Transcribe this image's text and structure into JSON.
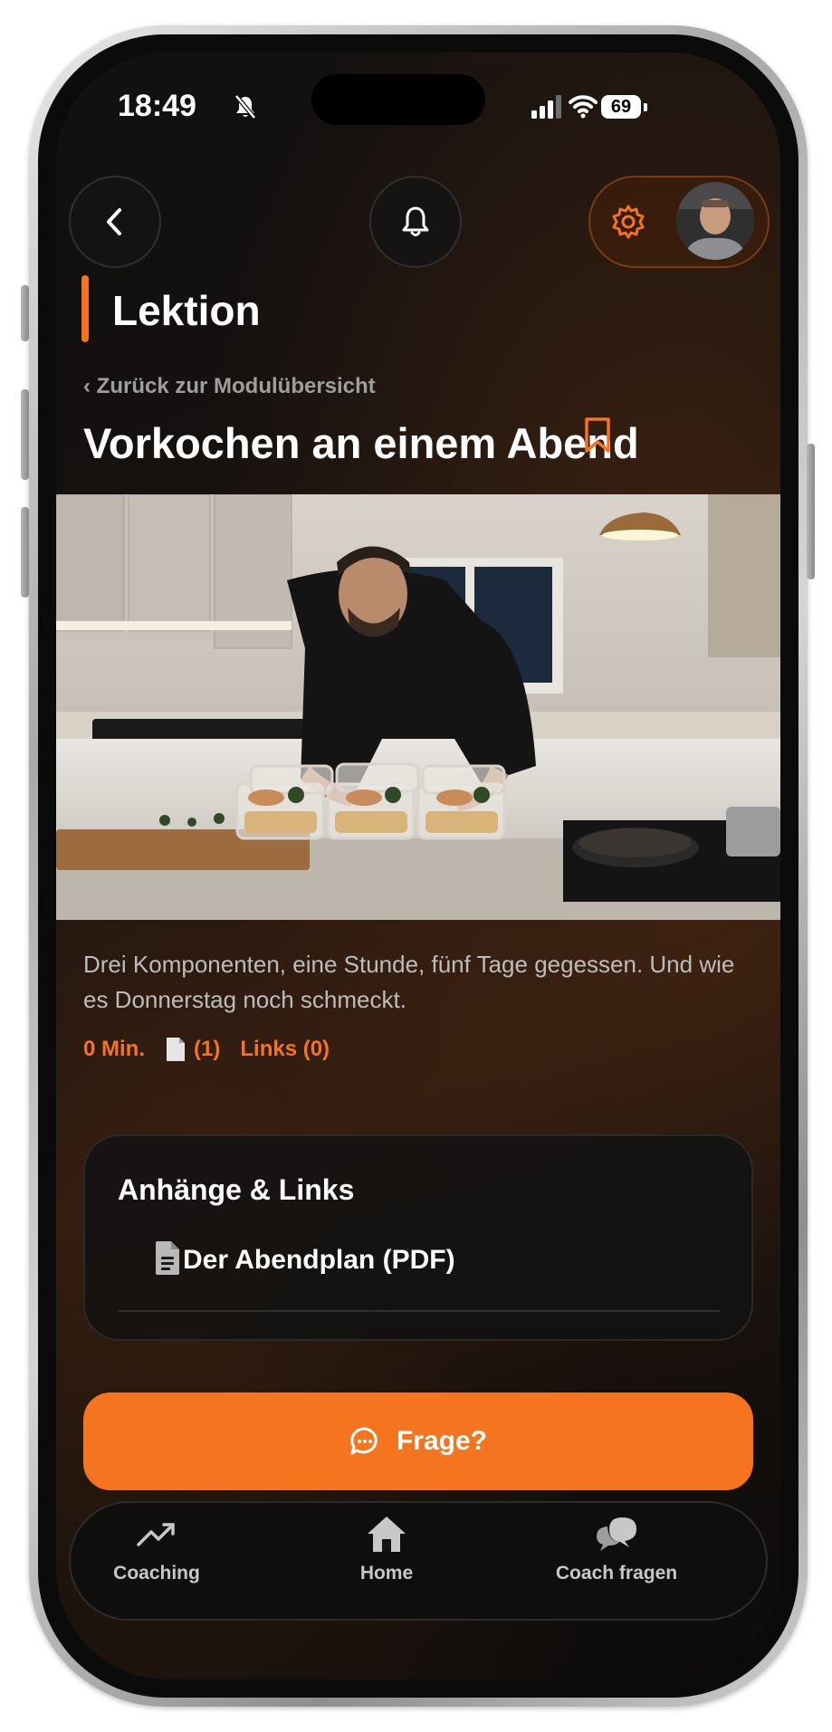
{
  "status_bar": {
    "time": "18:49",
    "battery": "69"
  },
  "header": {
    "back_icon": "chevron-left-icon",
    "bell_icon": "bell-icon",
    "settings_icon": "gear-icon"
  },
  "page": {
    "section_title": "Lektion",
    "back_link": "‹ Zurück zur Modulübersicht",
    "lesson_title": "Vorkochen an einem Abend",
    "description": "Drei Komponenten, eine Stunde, fünf Tage gegessen. Und wie es Donnerstag noch schmeckt.",
    "meta": {
      "duration": "0 Min.",
      "files": "(1)",
      "links": "Links (0)"
    }
  },
  "attachments": {
    "heading": "Anhänge & Links",
    "items": [
      {
        "name": "Der Abendplan (PDF)",
        "icon": "document-icon"
      }
    ]
  },
  "cta": {
    "label": "Frage?",
    "icon": "chat-bubble-icon"
  },
  "tabbar": {
    "items": [
      {
        "label": "Coaching",
        "icon": "trend-up-icon"
      },
      {
        "label": "Home",
        "icon": "home-icon"
      },
      {
        "label": "Coach fragen",
        "icon": "chat-bubbles-icon"
      }
    ]
  },
  "colors": {
    "accent": "#f47420",
    "background": "#121010",
    "text": "#ffffff",
    "muted": "#bdbdbd"
  }
}
